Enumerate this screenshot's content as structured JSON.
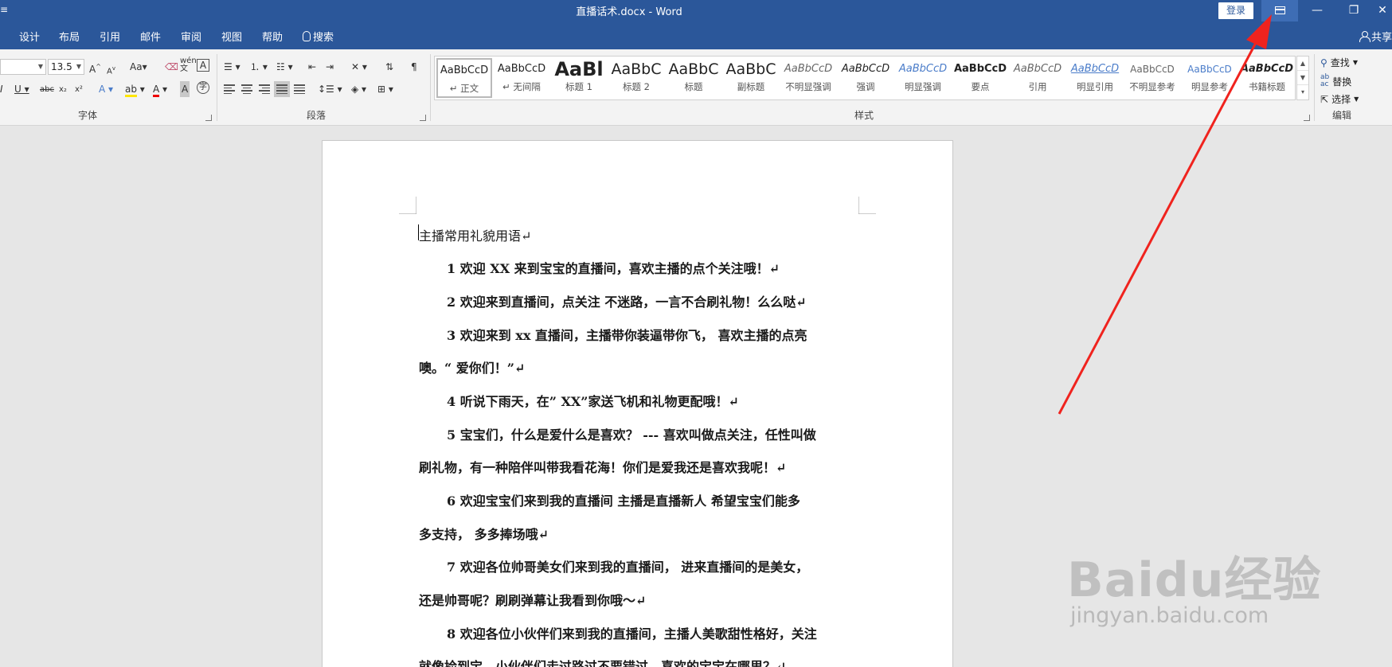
{
  "window": {
    "title": "直播话术.docx  -  Word",
    "login_label": "登录",
    "left_mark": "≡",
    "minimize": "—",
    "restore": "❐",
    "close": "✕",
    "ribbon_display_icon": "ribbon-display-options-icon"
  },
  "tabs": {
    "items": [
      "设计",
      "布局",
      "引用",
      "邮件",
      "审阅",
      "视图",
      "帮助"
    ],
    "search_label": "搜索",
    "share_label": "共享"
  },
  "ribbon": {
    "font_group_label": "字体",
    "paragraph_group_label": "段落",
    "styles_group_label": "样式",
    "editing_group_label": "编辑",
    "font_size_value": "13.5",
    "change_case_label": "Aa",
    "styles": [
      {
        "sample": "AaBbCcD",
        "name": "↵ 正文"
      },
      {
        "sample": "AaBbCcD",
        "name": "↵ 无间隔"
      },
      {
        "sample": "AaBl",
        "name": "标题 1"
      },
      {
        "sample": "AaBbC",
        "name": "标题 2"
      },
      {
        "sample": "AaBbC",
        "name": "标题"
      },
      {
        "sample": "AaBbC",
        "name": "副标题"
      },
      {
        "sample": "AaBbCcD",
        "name": "不明显强调"
      },
      {
        "sample": "AaBbCcD",
        "name": "强调"
      },
      {
        "sample": "AaBbCcD",
        "name": "明显强调"
      },
      {
        "sample": "AaBbCcD",
        "name": "要点"
      },
      {
        "sample": "AaBbCcD",
        "name": "引用"
      },
      {
        "sample": "AaBbCcD",
        "name": "明显引用"
      },
      {
        "sample": "AaBbCcD",
        "name": "不明显参考"
      },
      {
        "sample": "AaBbCcD",
        "name": "明显参考"
      },
      {
        "sample": "AaBbCcD",
        "name": "书籍标题"
      }
    ],
    "find_label": "查找",
    "replace_label": "替换",
    "select_label": "选择"
  },
  "document": {
    "title_line": "主播常用礼貌用语↵",
    "lines": [
      "1 欢迎  XX 来到宝宝的直播间，喜欢主播的点个关注哦！↵",
      "2 欢迎来到直播间，点关注  不迷路，一言不合刷礼物！么么哒↵",
      "3  欢迎来到  xx  直播间，主播带你装逼带你飞，   喜欢主播的点亮",
      "噢。“  爱你们！”↵",
      "4 听说下雨天，在” XX”家送飞机和礼物更配哦！↵",
      "5 宝宝们，什么是爱什么是喜欢？  ---  喜欢叫做点关注，任性叫做",
      "刷礼物，有一种陪伴叫带我看花海！你们是爱我还是喜欢我呢！↵",
      "6  欢迎宝宝们来到我的直播间  主播是直播新人  希望宝宝们能多",
      "多支持，   多多捧场哦↵",
      "7  欢迎各位帅哥美女们来到我的直播间，   进来直播间的是美女，",
      "还是帅哥呢？刷刷弹幕让我看到你哦～↵",
      "8 欢迎各位小伙伴们来到我的直播间，主播人美歌甜性格好，关注",
      "就像捡到宝，小伙伴们走过路过不要错过，喜欢的宝宝在哪里？↵"
    ]
  },
  "watermark": {
    "logo": "Baidu经验",
    "url": "jingyan.baidu.com"
  },
  "annotation": {
    "arrow_color": "#f0231e"
  }
}
